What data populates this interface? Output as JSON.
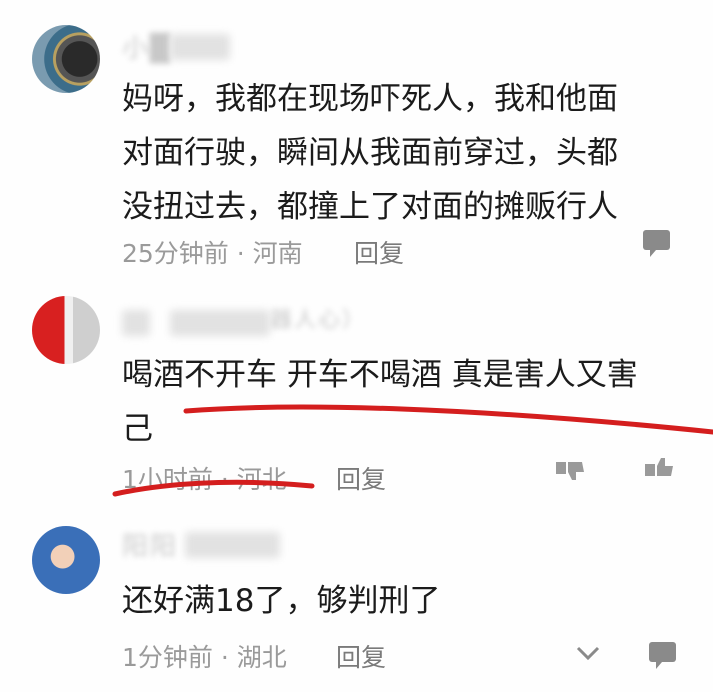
{
  "comments": [
    {
      "username": "小█",
      "text": "妈呀，我都在现场吓死人，我和他面\n对面行驶，瞬间从我面前穿过，头都\n没扭过去，都撞上了对面的摊贩行人",
      "meta": "25分钟前 · 河南",
      "reply_label": "回复"
    },
    {
      "username": "",
      "username_tail": "器人心）",
      "text": "喝酒不开车 开车不喝酒 真是害人又害\n己",
      "meta": "1小时前 · 河北",
      "reply_label": "回复"
    },
    {
      "username": "阳阳",
      "text": "还好满18了，够判刑了",
      "meta": "1分钟前 · 湖北",
      "reply_label": "回复"
    }
  ],
  "icons": {
    "comment1_action": "comment-icon",
    "comment2_action_left": "dislike-icon",
    "comment2_action_right": "like-icon",
    "comment3_action_left": "chevron-down-icon",
    "comment3_action_right": "comment-icon"
  },
  "colors": {
    "annotation_red": "#d41e1e",
    "text_primary": "#1b1b1b",
    "text_meta": "#9a9a9a"
  }
}
